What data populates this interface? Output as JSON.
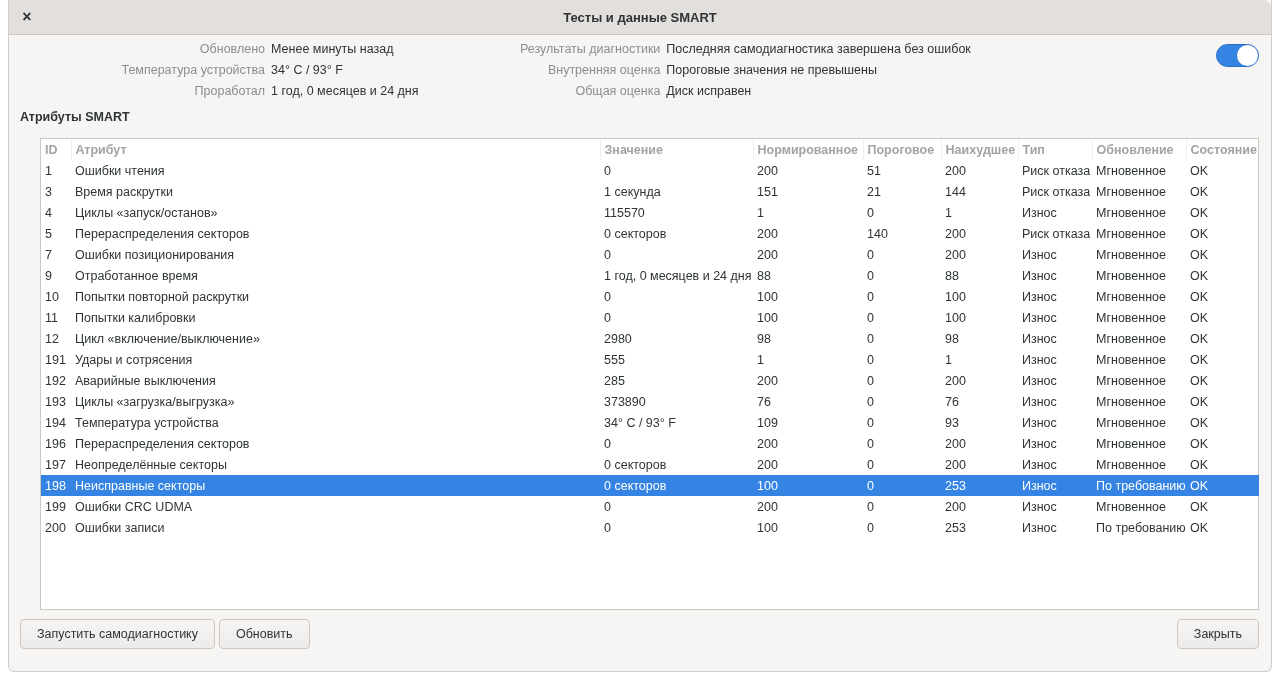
{
  "window": {
    "title": "Тесты и данные SMART",
    "close": "×"
  },
  "info_left": [
    {
      "label": "Обновлено",
      "value": "Менее минуты назад"
    },
    {
      "label": "Температура устройства",
      "value": "34° C / 93° F"
    },
    {
      "label": "Проработал",
      "value": "1 год, 0 месяцев и 24 дня"
    }
  ],
  "info_right": [
    {
      "label": "Результаты диагностики",
      "value": "Последняя самодиагностика завершена без ошибок"
    },
    {
      "label": "Внутренняя оценка",
      "value": "Пороговые значения не превышены"
    },
    {
      "label": "Общая оценка",
      "value": "Диск исправен"
    }
  ],
  "smart_toggle": {
    "on": true
  },
  "section_title": "Атрибуты SMART",
  "table": {
    "columns": [
      "ID",
      "Атрибут",
      "Значение",
      "Нормированное",
      "Пороговое",
      "Наихудшее",
      "Тип",
      "Обновление",
      "Состояние"
    ],
    "rows": [
      {
        "cells": [
          "1",
          "Ошибки чтения",
          "0",
          "200",
          "51",
          "200",
          "Риск отказа",
          "Мгновенное",
          "OK"
        ],
        "selected": false
      },
      {
        "cells": [
          "3",
          "Время раскрутки",
          "1 секунда",
          "151",
          "21",
          "144",
          "Риск отказа",
          "Мгновенное",
          "OK"
        ],
        "selected": false
      },
      {
        "cells": [
          "4",
          "Циклы «запуск/останов»",
          "115570",
          "1",
          "0",
          "1",
          "Износ",
          "Мгновенное",
          "OK"
        ],
        "selected": false
      },
      {
        "cells": [
          "5",
          "Перераспределения секторов",
          "0 секторов",
          "200",
          "140",
          "200",
          "Риск отказа",
          "Мгновенное",
          "OK"
        ],
        "selected": false
      },
      {
        "cells": [
          "7",
          "Ошибки позиционирования",
          "0",
          "200",
          "0",
          "200",
          "Износ",
          "Мгновенное",
          "OK"
        ],
        "selected": false
      },
      {
        "cells": [
          "9",
          "Отработанное время",
          "1 год, 0 месяцев и 24 дня",
          "88",
          "0",
          "88",
          "Износ",
          "Мгновенное",
          "OK"
        ],
        "selected": false
      },
      {
        "cells": [
          "10",
          "Попытки повторной раскрутки",
          "0",
          "100",
          "0",
          "100",
          "Износ",
          "Мгновенное",
          "OK"
        ],
        "selected": false
      },
      {
        "cells": [
          "11",
          "Попытки калибровки",
          "0",
          "100",
          "0",
          "100",
          "Износ",
          "Мгновенное",
          "OK"
        ],
        "selected": false
      },
      {
        "cells": [
          "12",
          "Цикл «включение/выключение»",
          "2980",
          "98",
          "0",
          "98",
          "Износ",
          "Мгновенное",
          "OK"
        ],
        "selected": false
      },
      {
        "cells": [
          "191",
          "Удары и сотрясения",
          "555",
          "1",
          "0",
          "1",
          "Износ",
          "Мгновенное",
          "OK"
        ],
        "selected": false
      },
      {
        "cells": [
          "192",
          "Аварийные выключения",
          "285",
          "200",
          "0",
          "200",
          "Износ",
          "Мгновенное",
          "OK"
        ],
        "selected": false
      },
      {
        "cells": [
          "193",
          "Циклы «загрузка/выгрузка»",
          "373890",
          "76",
          "0",
          "76",
          "Износ",
          "Мгновенное",
          "OK"
        ],
        "selected": false
      },
      {
        "cells": [
          "194",
          "Температура устройства",
          "34° C / 93° F",
          "109",
          "0",
          "93",
          "Износ",
          "Мгновенное",
          "OK"
        ],
        "selected": false
      },
      {
        "cells": [
          "196",
          "Перераспределения секторов",
          "0",
          "200",
          "0",
          "200",
          "Износ",
          "Мгновенное",
          "OK"
        ],
        "selected": false
      },
      {
        "cells": [
          "197",
          "Неопределённые секторы",
          "0 секторов",
          "200",
          "0",
          "200",
          "Износ",
          "Мгновенное",
          "OK"
        ],
        "selected": false
      },
      {
        "cells": [
          "198",
          "Неисправные секторы",
          "0 секторов",
          "100",
          "0",
          "253",
          "Износ",
          "По требованию",
          "OK"
        ],
        "selected": true
      },
      {
        "cells": [
          "199",
          "Ошибки CRC UDMA",
          "0",
          "200",
          "0",
          "200",
          "Износ",
          "Мгновенное",
          "OK"
        ],
        "selected": false
      },
      {
        "cells": [
          "200",
          "Ошибки записи",
          "0",
          "100",
          "0",
          "253",
          "Износ",
          "По требованию",
          "OK"
        ],
        "selected": false
      }
    ]
  },
  "buttons_left": [
    "Запустить самодиагностику",
    "Обновить"
  ],
  "buttons_right": [
    "Закрыть"
  ]
}
